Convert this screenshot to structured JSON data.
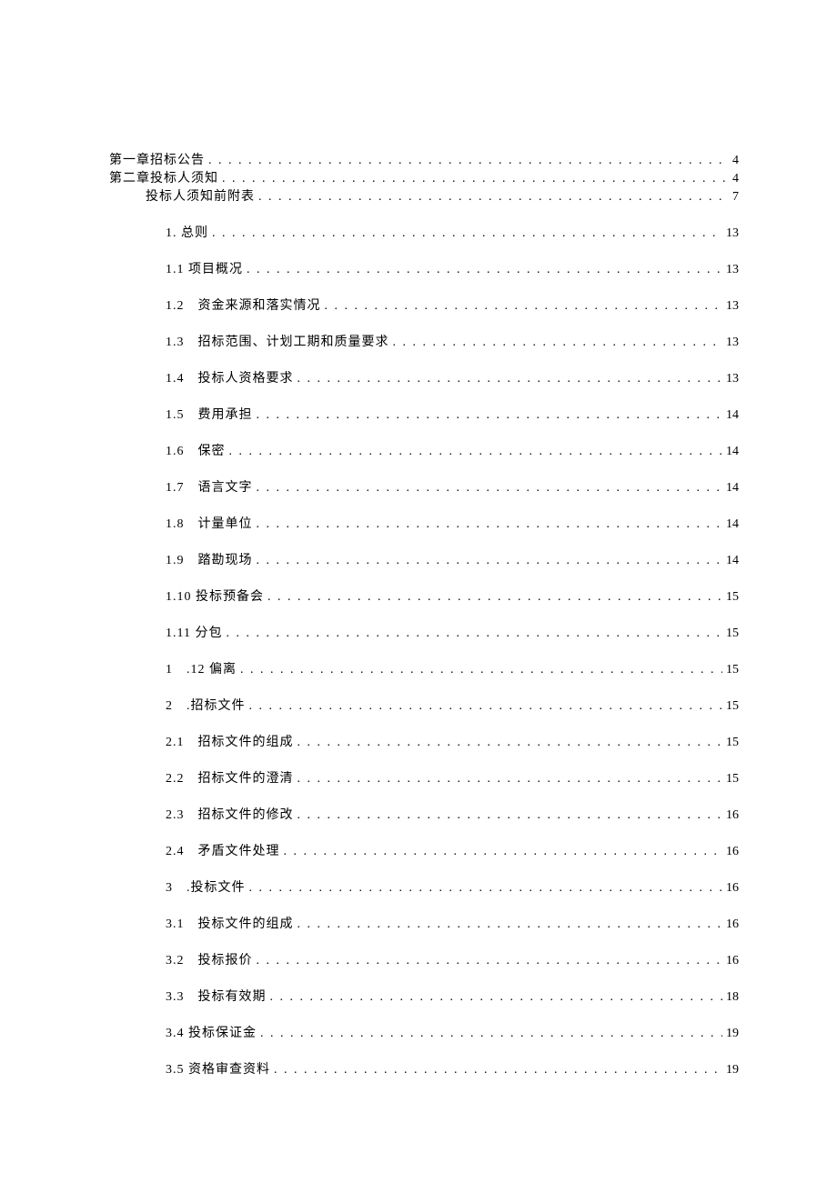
{
  "toc": {
    "top": [
      {
        "indent": 0,
        "label": "第一章招标公告",
        "page": "4"
      },
      {
        "indent": 0,
        "label": "第二章投标人须知",
        "page": "4"
      },
      {
        "indent": 40,
        "label": "投标人须知前附表",
        "page": "7"
      }
    ],
    "items": [
      {
        "indent": 62,
        "label": "1. 总则",
        "page": "13"
      },
      {
        "indent": 62,
        "label": "1.1 项目概况",
        "page": "13"
      },
      {
        "indent": 62,
        "label": "1.2 资金来源和落实情况",
        "page": "13"
      },
      {
        "indent": 62,
        "label": "1.3 招标范围、计划工期和质量要求",
        "page": "13"
      },
      {
        "indent": 62,
        "label": "1.4 投标人资格要求",
        "page": "13"
      },
      {
        "indent": 62,
        "label": "1.5 费用承担",
        "page": "14"
      },
      {
        "indent": 62,
        "label": "1.6 保密",
        "page": "14"
      },
      {
        "indent": 62,
        "label": "1.7 语言文字",
        "page": "14"
      },
      {
        "indent": 62,
        "label": "1.8 计量单位",
        "page": "14"
      },
      {
        "indent": 62,
        "label": "1.9 踏勘现场",
        "page": "14"
      },
      {
        "indent": 62,
        "label": "1.10 投标预备会",
        "page": "15"
      },
      {
        "indent": 62,
        "label": "1.11 分包",
        "page": "15"
      },
      {
        "indent": 62,
        "label": "1 .12 偏离",
        "page": "15"
      },
      {
        "indent": 62,
        "label": "2 .招标文件",
        "page": "15"
      },
      {
        "indent": 62,
        "label": "2.1 招标文件的组成",
        "page": "15"
      },
      {
        "indent": 62,
        "label": "2.2 招标文件的澄清",
        "page": "15"
      },
      {
        "indent": 62,
        "label": "2.3 招标文件的修改",
        "page": "16"
      },
      {
        "indent": 62,
        "label": "2.4 矛盾文件处理",
        "page": "16"
      },
      {
        "indent": 62,
        "label": "3 .投标文件",
        "page": "16"
      },
      {
        "indent": 62,
        "label": "3.1 投标文件的组成",
        "page": "16"
      },
      {
        "indent": 62,
        "label": "3.2 投标报价",
        "page": "16"
      },
      {
        "indent": 62,
        "label": "3.3 投标有效期",
        "page": "18"
      },
      {
        "indent": 62,
        "label": "3.4 投标保证金",
        "page": "19"
      },
      {
        "indent": 62,
        "label": "3.5 资格审查资料",
        "page": "19"
      }
    ]
  }
}
